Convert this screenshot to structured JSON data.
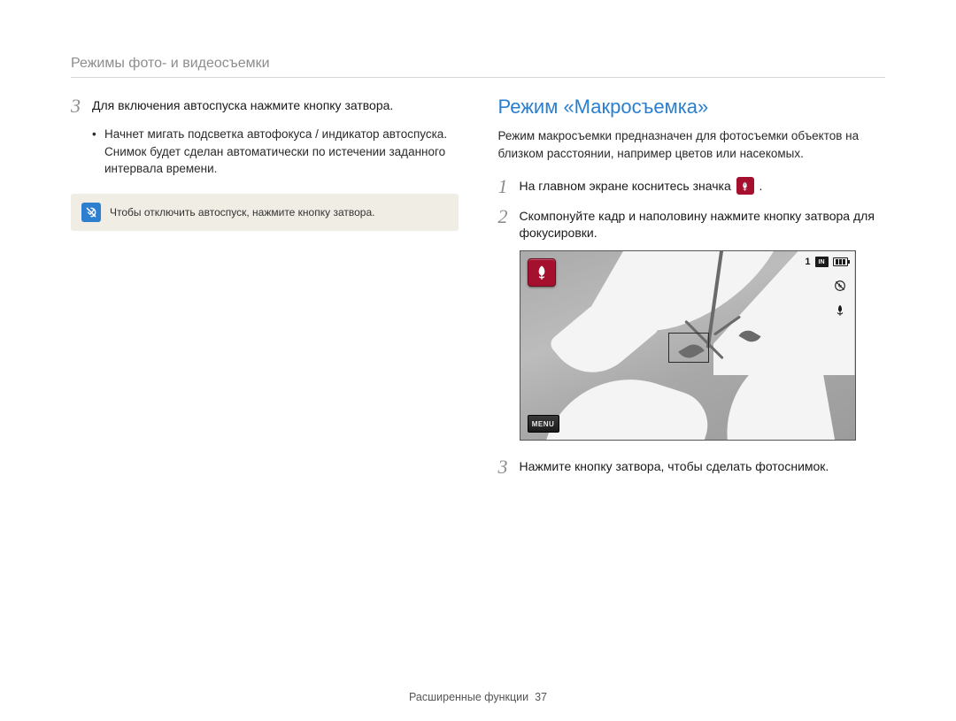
{
  "header": "Режимы фото- и видеосъемки",
  "left": {
    "step3": {
      "num": "3",
      "text": "Для включения автоспуска нажмите кнопку затвора.",
      "bullet": "Начнет мигать подсветка автофокуса / индикатор автоспуска. Снимок будет сделан автоматически по истечении заданного интервала времени."
    },
    "note": "Чтобы отключить автоспуск, нажмите кнопку затвора."
  },
  "right": {
    "title": "Режим «Макросъемка»",
    "desc": "Режим макросъемки предназначен для фотосъемки объектов на близком расстоянии, например цветов или насекомых.",
    "step1": {
      "num": "1",
      "before": "На главном экране коснитесь значка ",
      "after": "."
    },
    "step2": {
      "num": "2",
      "text": "Скомпонуйте кадр и наполовину нажмите кнопку затвора для фокусировки."
    },
    "step3": {
      "num": "3",
      "text": "Нажмите кнопку затвора, чтобы сделать фотоснимок."
    },
    "shot": {
      "count": "1",
      "in": "IN",
      "menu": "MENU"
    }
  },
  "footer": {
    "label": "Расширенные функции",
    "page": "37"
  }
}
